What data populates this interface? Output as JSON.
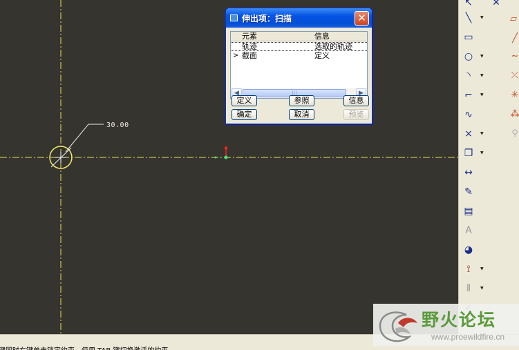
{
  "canvas": {
    "background": "#36342f",
    "dimension_value": "30.00",
    "centerline_color": "#e8e05a"
  },
  "dialog": {
    "title": "伸出项：扫描",
    "close_glyph": "✕",
    "columns": [
      "元素",
      "信息"
    ],
    "rows": [
      {
        "element": "轨迹",
        "info": "选取的轨迹",
        "marker": ""
      },
      {
        "element": "截面",
        "info": "定义",
        "marker": ">"
      }
    ],
    "scroll_thumb_glyph": "|||",
    "buttons": {
      "define": "定义",
      "reference": "参照",
      "info": "信息",
      "ok": "确定",
      "cancel": "取消",
      "preview": "预览"
    }
  },
  "toolbar": {
    "icons": [
      "select-icon",
      "line-icon",
      "rectangle-icon",
      "circle-icon",
      "arc-icon",
      "fillet-icon",
      "spline-icon",
      "point-icon",
      "offset-icon",
      "dimension-icon",
      "modify-icon",
      "constraint-icon",
      "text-icon",
      "palette-icon",
      "trim-icon",
      "mirror-icon",
      "done-icon"
    ]
  },
  "status": {
    "message": "键同时右键单击锁定约束，使用 TAB 键切换激活的约束。"
  },
  "watermark": {
    "name": "野火论坛",
    "url": "www.proewildfire.cn"
  }
}
